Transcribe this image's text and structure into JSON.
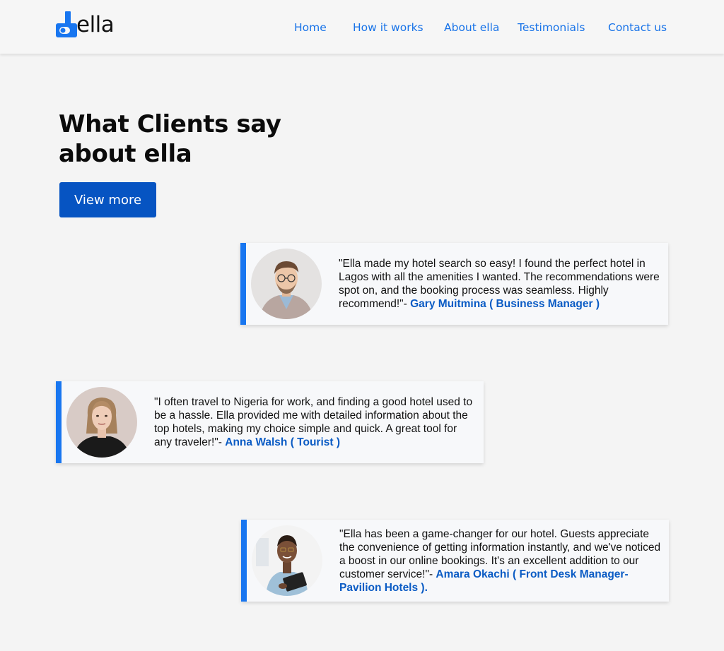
{
  "header": {
    "logo_text": "ella",
    "nav": [
      {
        "label": "Home"
      },
      {
        "label": "How it works"
      },
      {
        "label": "About ella"
      },
      {
        "label": "Testimonials"
      },
      {
        "label": "Contact us"
      }
    ]
  },
  "hero": {
    "title": "What Clients say about ella",
    "button_label": "View more"
  },
  "testimonials": [
    {
      "quote": "\"Ella made my hotel search so easy! I found the perfect hotel in Lagos with all the amenities I wanted. The recommendations were spot on, and the booking process was seamless. Highly recommend!\"- ",
      "author": "Gary Muitmina ( Business Manager )"
    },
    {
      "quote": "\"I often travel to Nigeria for work, and finding a good hotel used to be a hassle. Ella provided me with detailed information about the top hotels, making my choice simple and quick. A great tool for any traveler!\"- ",
      "author": "Anna Walsh ( Tourist )"
    },
    {
      "quote": "\"Ella has been a game-changer for our hotel. Guests appreciate the convenience of getting information instantly, and we've noticed a boost in our online bookings. It's an excellent addition to our customer service!\"- ",
      "author": "Amara Okachi ( Front Desk Manager- Pavilion Hotels )."
    }
  ],
  "colors": {
    "accent": "#1876f0",
    "button": "#0654c2",
    "author": "#0a5bc4",
    "background": "#f4f4f4"
  }
}
